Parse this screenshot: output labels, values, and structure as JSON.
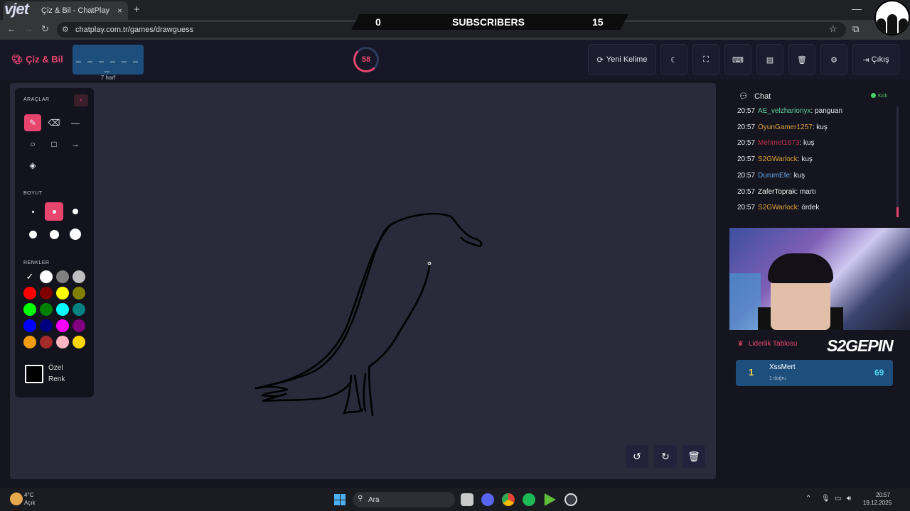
{
  "browser": {
    "tab_title": "Çiz & Bil - ChatPlay",
    "tab_close": "×",
    "new_tab": "+",
    "url": "chatplay.com.tr/games/drawguess",
    "overlay_logo": "vjet"
  },
  "stream_overlay": {
    "left_count": "0",
    "label": "SUBSCRIBERS",
    "right_count": "15"
  },
  "header": {
    "brand": "Çiz & Bil",
    "word_mask": "_ _ _ _ _ _ _",
    "word_length": "7 harf",
    "timer": "58",
    "new_word": "Yeni Kelime",
    "exit": "Çıkış"
  },
  "tools": {
    "section_tools": "ARAÇLAR",
    "section_size": "BOYUT",
    "section_colors": "RENKLER",
    "custom_color_line1": "Özel",
    "custom_color_line2": "Renk",
    "active_tool": "brush",
    "active_size_index": 1,
    "selected_color": "#000000",
    "colors": [
      "#000000",
      "#ffffff",
      "#808080",
      "#c0c0c0",
      "#ff0000",
      "#800000",
      "#ffff00",
      "#808000",
      "#00ff00",
      "#008000",
      "#00ffff",
      "#008080",
      "#0000ff",
      "#000080",
      "#ff00ff",
      "#800080",
      "#f39c12",
      "#a52a2a",
      "#ffb6c1",
      "#ffd700"
    ]
  },
  "accent": "#e8456e",
  "chat": {
    "title": "Chat",
    "platform": "Kick",
    "messages": [
      {
        "time": "20:57",
        "user": "AE_velzharionyx",
        "text": ": panguan",
        "color": "#5fd0a0"
      },
      {
        "time": "20:57",
        "user": "OyunGamer1257",
        "text": ": kuş",
        "color": "#e0a040"
      },
      {
        "time": "20:57",
        "user": "Mehmet1673",
        "text": ": kuş",
        "color": "#c0304a"
      },
      {
        "time": "20:57",
        "user": "S2GWarlock",
        "text": ": kuş",
        "color": "#e0a030"
      },
      {
        "time": "20:57",
        "user": "DurumEfe",
        "text": ": kuş",
        "color": "#6aa8e8"
      },
      {
        "time": "20:57",
        "user": "ZaferToprak",
        "text": ": martı",
        "color": "#f0f0f0"
      },
      {
        "time": "20:57",
        "user": "S2GWarlock",
        "text": ": ördek",
        "color": "#e0a030"
      }
    ]
  },
  "leaderboard": {
    "title": "Liderlik Tablosu",
    "logo_text": "S2GEPIN",
    "rows": [
      {
        "rank": "1",
        "name": "XssMert",
        "detail": "1 doğru",
        "score": "69"
      }
    ]
  },
  "taskbar": {
    "temperature": "4°C",
    "condition": "Açık",
    "search_placeholder": "Ara",
    "time": "20:57",
    "date": "19.12.2025"
  }
}
